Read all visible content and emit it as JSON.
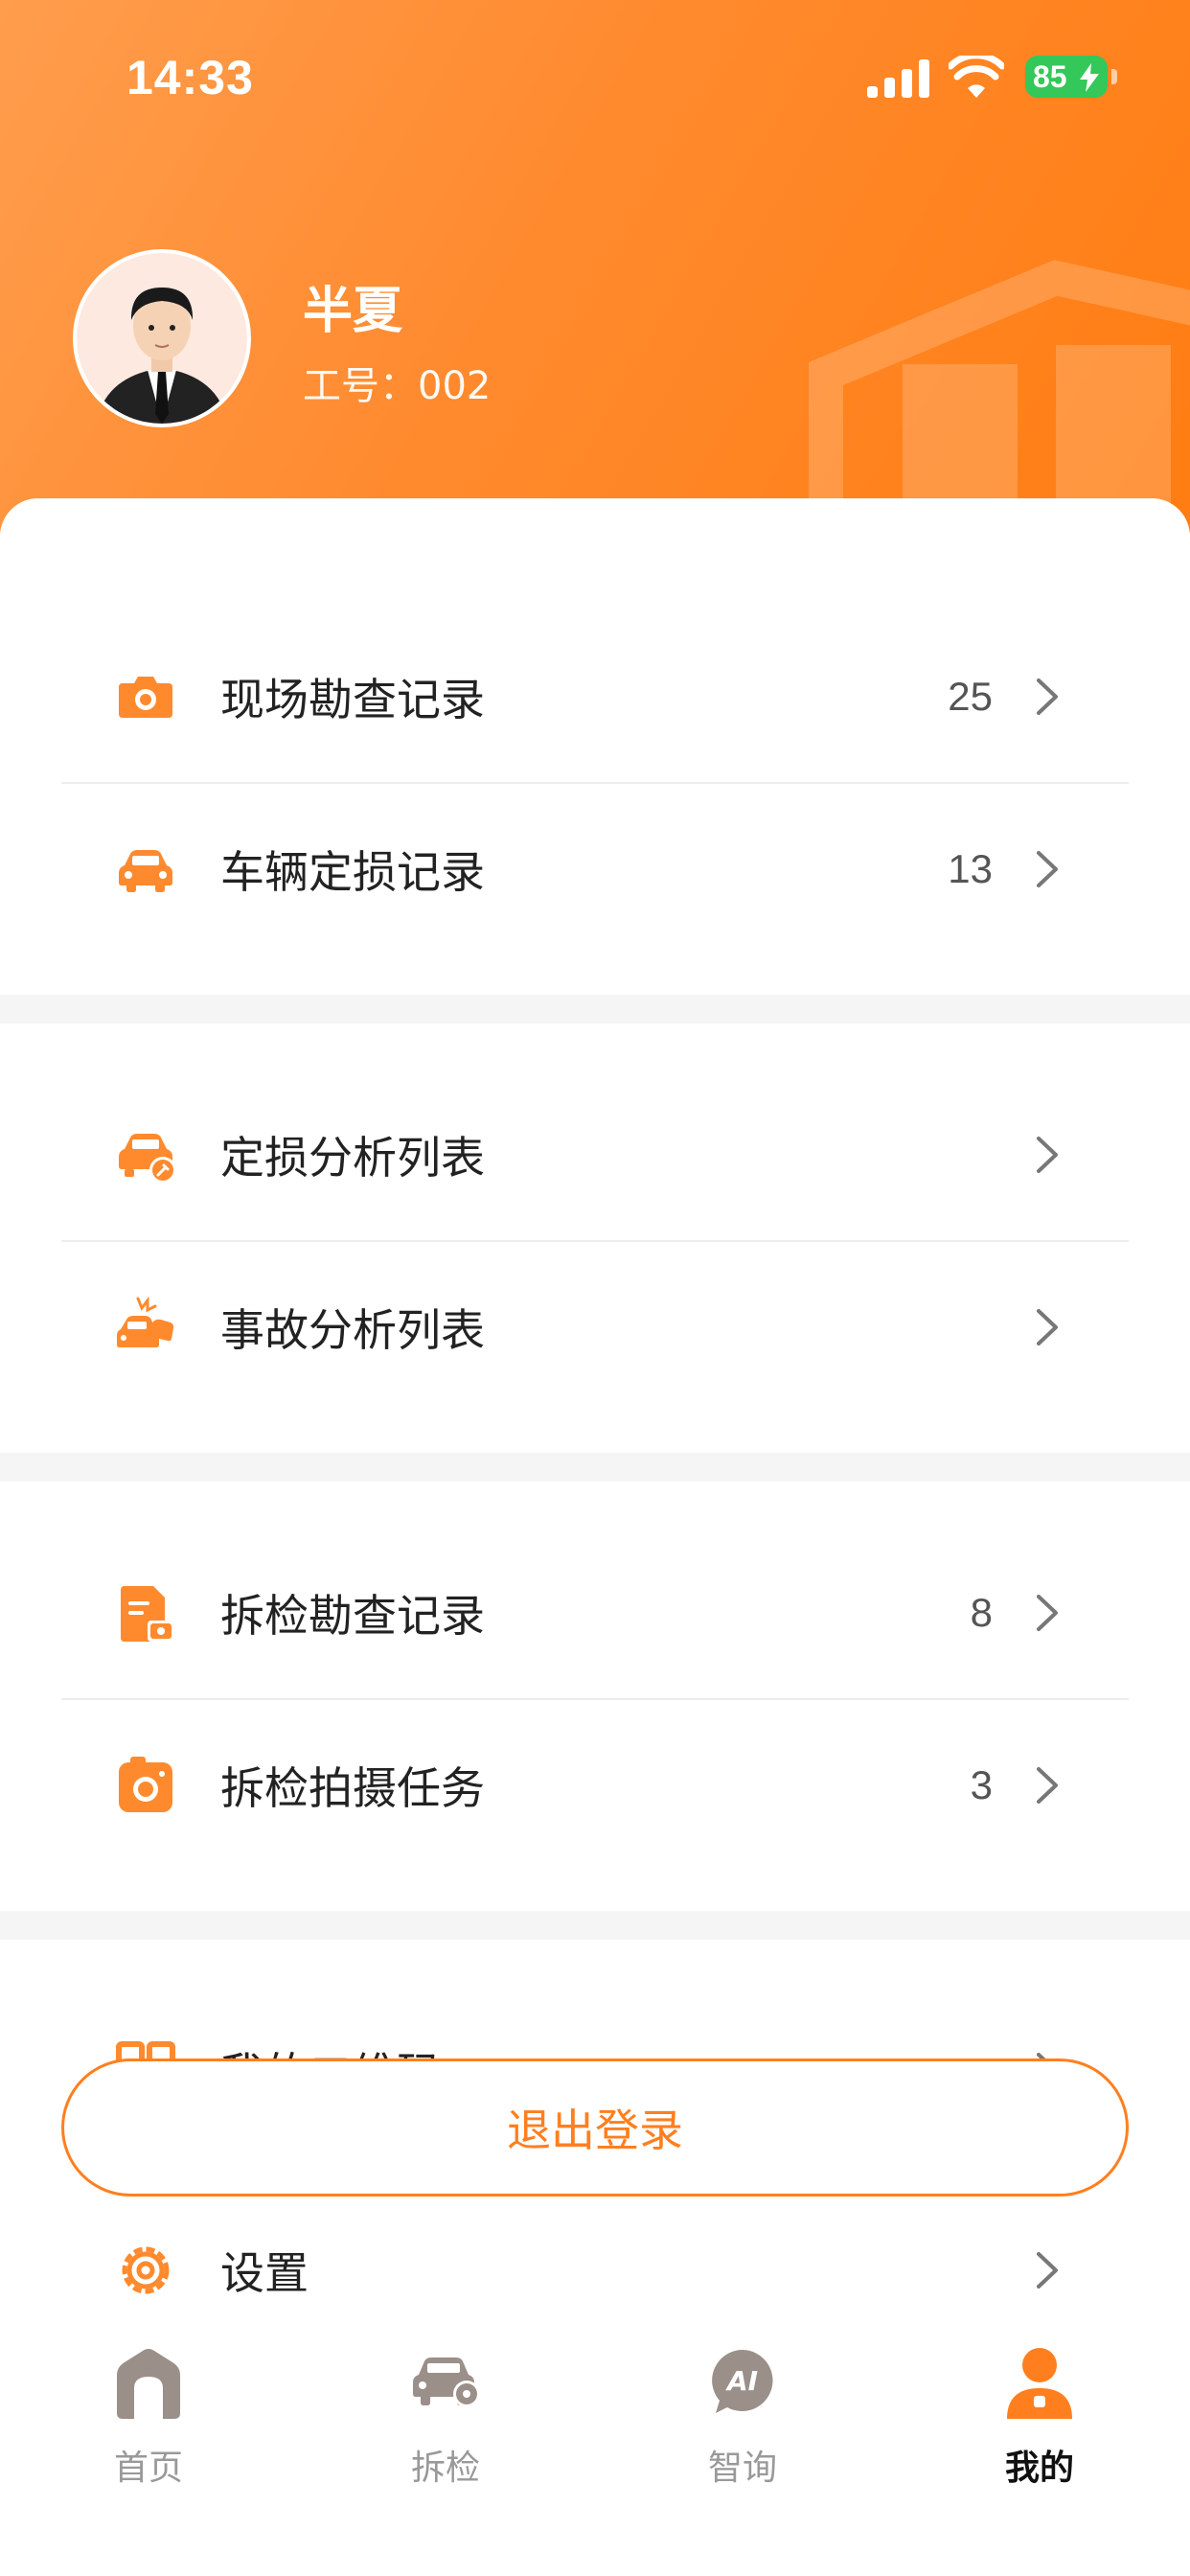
{
  "status_bar": {
    "time": "14:33",
    "battery": "85"
  },
  "profile": {
    "name": "半夏",
    "employee_no": "工号：002"
  },
  "menu_groups": [
    [
      {
        "label": "现场勘查记录",
        "count": "25",
        "icon": "camera-icon"
      },
      {
        "label": "车辆定损记录",
        "count": "13",
        "icon": "car-icon"
      }
    ],
    [
      {
        "label": "定损分析列表",
        "count": "",
        "icon": "car-wrench-icon"
      },
      {
        "label": "事故分析列表",
        "count": "",
        "icon": "car-crash-icon"
      }
    ],
    [
      {
        "label": "拆检勘查记录",
        "count": "8",
        "icon": "document-camera-icon"
      },
      {
        "label": "拆检拍摄任务",
        "count": "3",
        "icon": "camera-task-icon"
      }
    ],
    [
      {
        "label": "我的二维码",
        "count": "",
        "icon": "qrcode-icon"
      },
      {
        "label": "设置",
        "count": "",
        "icon": "gear-icon"
      }
    ]
  ],
  "logout_label": "退出登录",
  "tabs": [
    {
      "label": "首页",
      "icon": "home-icon",
      "active": false
    },
    {
      "label": "拆检",
      "icon": "car-inspect-icon",
      "active": false
    },
    {
      "label": "智询",
      "icon": "ai-chat-icon",
      "active": false
    },
    {
      "label": "我的",
      "icon": "user-icon",
      "active": true
    }
  ],
  "colors": {
    "accent": "#ff7f1f",
    "battery": "#34c759"
  }
}
